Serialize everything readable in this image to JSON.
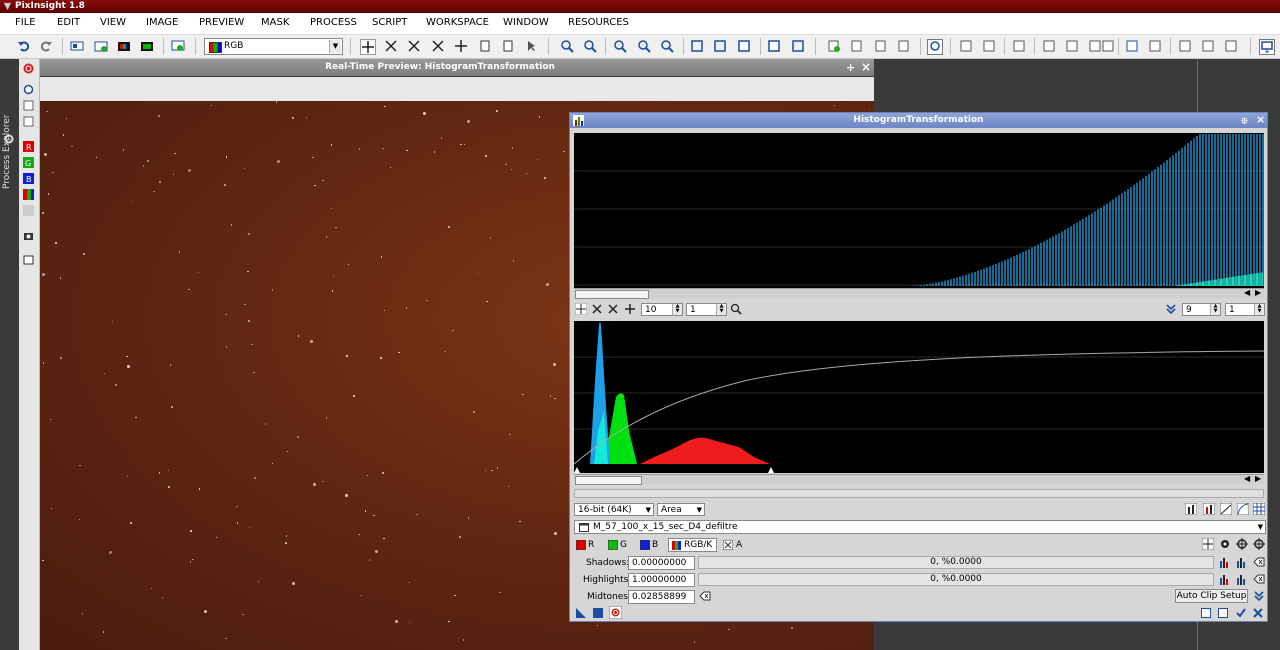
{
  "app": {
    "title": "PixInsight 1.8"
  },
  "menu": [
    "FILE",
    "EDIT",
    "VIEW",
    "IMAGE",
    "PREVIEW",
    "MASK",
    "PROCESS",
    "SCRIPT",
    "WORKSPACE",
    "WINDOW",
    "RESOURCES"
  ],
  "toolbar": {
    "color_mode": "RGB"
  },
  "left_tab": {
    "label": "Process Explorer"
  },
  "preview": {
    "title": "Real-Time Preview: HistogramTransformation",
    "pin": "+",
    "close": "×"
  },
  "histogram": {
    "title": "HistogramTransformation",
    "top_zoom_h": "10",
    "top_zoom_v": "1",
    "right_zoom_h": "9",
    "right_zoom_v": "1",
    "bit_depth": "16-bit (64K)",
    "graph_style": "Area",
    "view": "M_57_100_x_15_sec_D4_defiltre",
    "channels": {
      "r": "R",
      "g": "G",
      "b": "B",
      "rgbk": "RGB/K",
      "a": "A"
    },
    "shadows_label": "Shadows:",
    "shadows_value": "0.00000000",
    "shadows_clip": "0, %0.0000",
    "highlights_label": "Highlights:",
    "highlights_value": "1.00000000",
    "highlights_clip": "0, %0.0000",
    "midtones_label": "Midtones:",
    "midtones_value": "0.02858899",
    "auto_clip": "Auto Clip Setup"
  }
}
